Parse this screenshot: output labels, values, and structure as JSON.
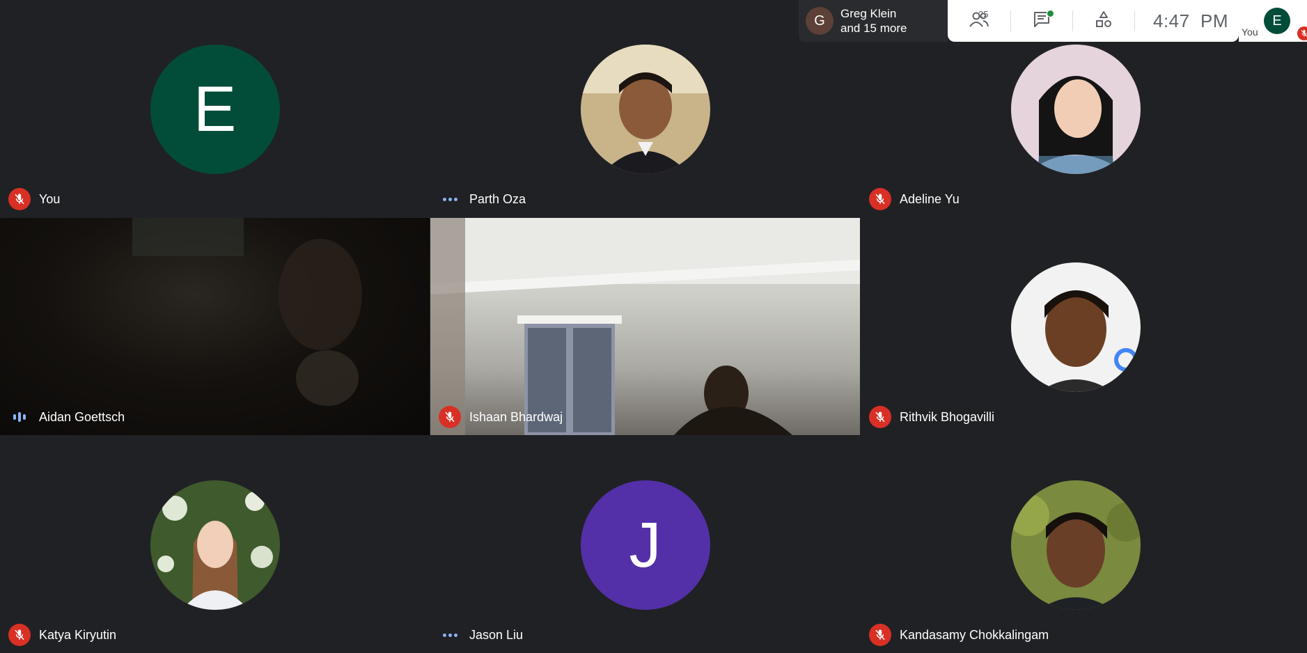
{
  "participants": [
    {
      "name": "You",
      "status": "muted",
      "avatar_letter": "E"
    },
    {
      "name": "Parth Oza",
      "status": "connecting"
    },
    {
      "name": "Adeline Yu",
      "status": "muted"
    },
    {
      "name": "Aidan Goettsch",
      "status": "speaking"
    },
    {
      "name": "Ishaan Bhardwaj",
      "status": "muted"
    },
    {
      "name": "Rithvik Bhogavilli",
      "status": "muted"
    },
    {
      "name": "Katya Kiryutin",
      "status": "muted"
    },
    {
      "name": "Jason Liu",
      "status": "connecting",
      "avatar_letter": "J"
    },
    {
      "name": "Kandasamy Chokkalingam",
      "status": "muted"
    }
  ],
  "presenter": {
    "avatar_letter": "G",
    "line1": "Greg Klein",
    "line2": "and 15 more"
  },
  "toolbar": {
    "people_count": "25",
    "time": "4:47  PM"
  },
  "self_chip": {
    "avatar_letter": "E",
    "label": "You"
  },
  "colors": {
    "background": "#202124",
    "muted_red": "#d93025",
    "avatar_e": "#024d3a",
    "avatar_j": "#5330a8"
  },
  "icons": {
    "people": "people-icon",
    "chat": "chat-icon",
    "activities": "activities-icon",
    "mic_off": "mic-off-icon"
  }
}
